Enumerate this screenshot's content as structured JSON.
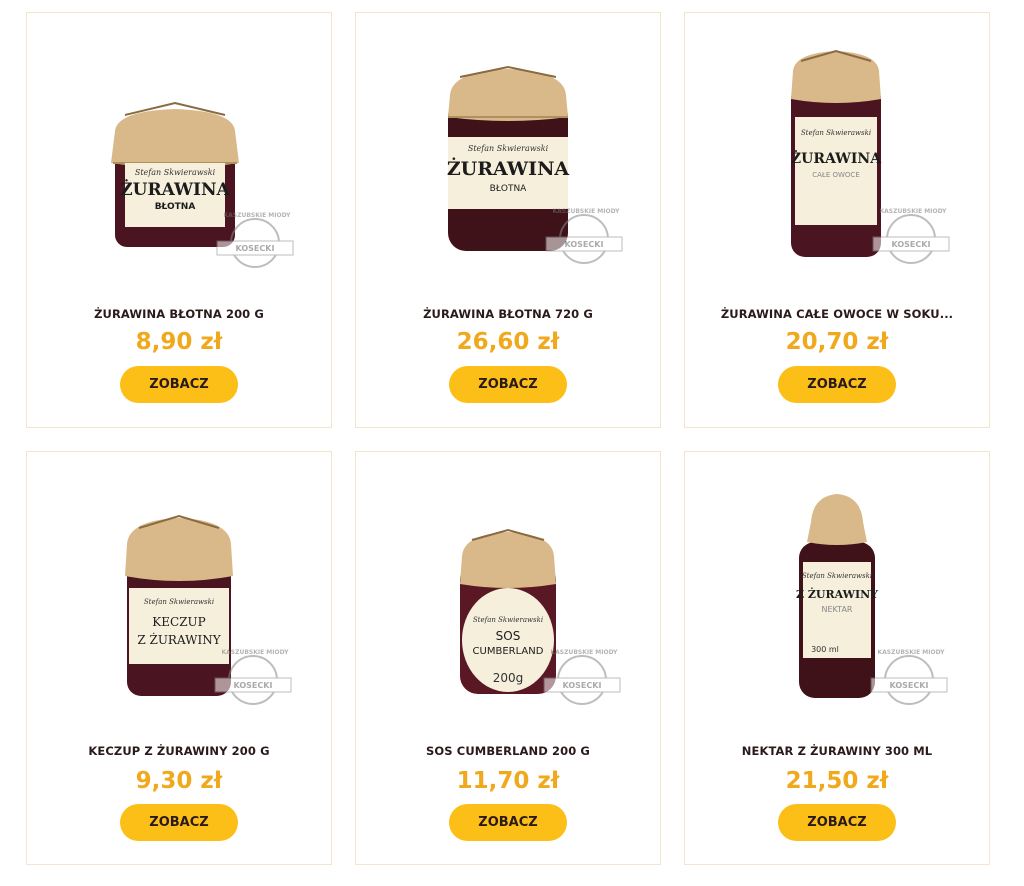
{
  "products": [
    {
      "name": "ŻURAWINA BŁOTNA 200 G",
      "price": "8,90 zł",
      "button": "ZOBACZ",
      "label_brand": "Stefan Skwierawski",
      "label_title": "ŻURAWINA",
      "label_sub": "BŁOTNA",
      "jar_icon": "jar-short-icon"
    },
    {
      "name": "ŻURAWINA BŁOTNA 720 G",
      "price": "26,60 zł",
      "button": "ZOBACZ",
      "label_brand": "Stefan Skwierawski",
      "label_title": "ŻURAWINA",
      "label_sub": "BŁOTNA",
      "jar_icon": "jar-large-icon"
    },
    {
      "name": "ŻURAWINA CAŁE OWOCE W SOKU...",
      "price": "20,70 zł",
      "button": "ZOBACZ",
      "label_brand": "Stefan Skwierawski",
      "label_title": "ŻURAWINA",
      "label_sub": "CAŁE OWOCE",
      "jar_icon": "jar-tall-icon"
    },
    {
      "name": "KECZUP Z ŻURAWINY 200 G",
      "price": "9,30 zł",
      "button": "ZOBACZ",
      "label_brand": "Stefan Skwierawski",
      "label_title": "KECZUP",
      "label_sub": "Z ŻURAWINY",
      "jar_icon": "jar-medium-icon"
    },
    {
      "name": "SOS CUMBERLAND 200 G",
      "price": "11,70 zł",
      "button": "ZOBACZ",
      "label_brand": "Stefan Skwierawski",
      "label_title": "SOS",
      "label_sub": "CUMBERLAND",
      "label_weight": "200g",
      "jar_icon": "jar-round-icon"
    },
    {
      "name": "NEKTAR Z ŻURAWINY 300 ML",
      "price": "21,50 zł",
      "button": "ZOBACZ",
      "label_brand": "Stefan Skwierawski",
      "label_title": "Z ŻURAWINY",
      "label_sub": "NEKTAR",
      "label_weight": "300 ml",
      "jar_icon": "bottle-icon"
    }
  ],
  "watermark": {
    "top": "KASZUBSKIE MIODY",
    "bottom": "KOSECKI"
  },
  "colors": {
    "accent": "#fcbf17",
    "price": "#f0a91c",
    "title": "#2b1a1a",
    "card_border": "#f3e6cc",
    "jam": "#4a1420",
    "paper": "#d9b98a",
    "label": "#f5efdc"
  }
}
